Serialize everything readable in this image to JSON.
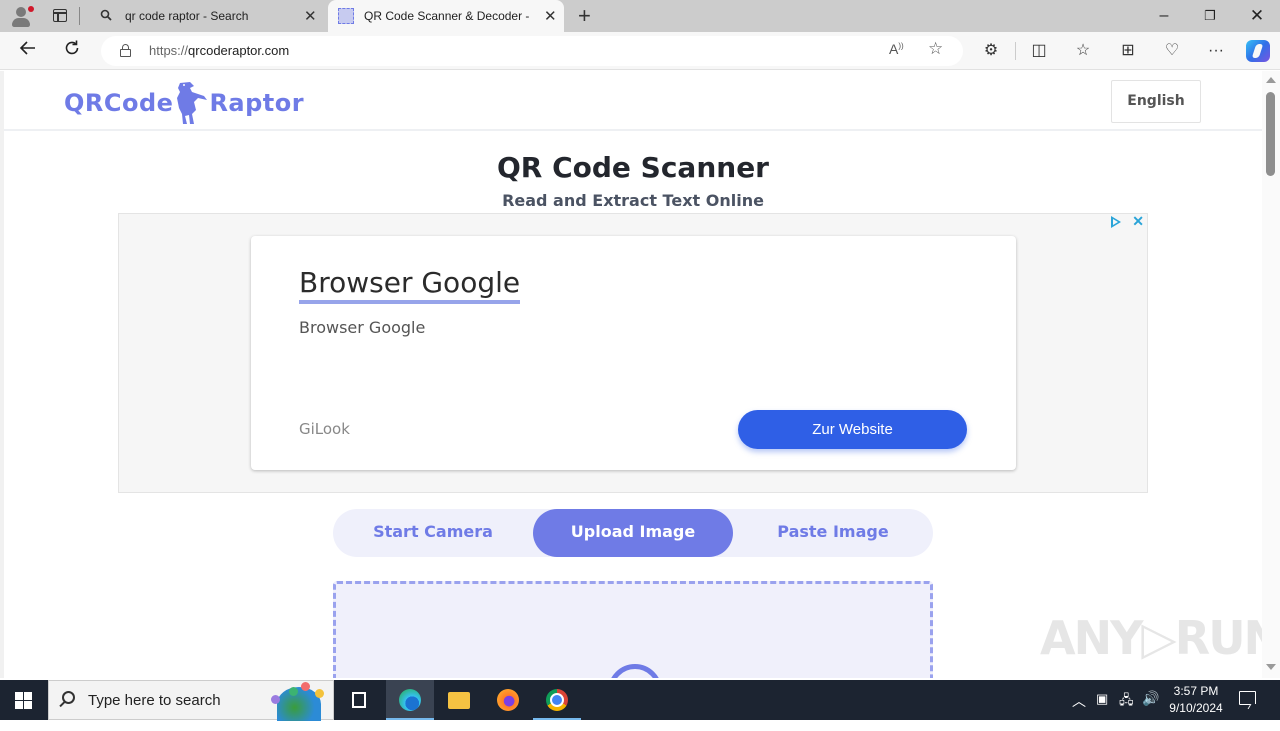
{
  "browser": {
    "tabs": [
      {
        "label": "qr code raptor - Search",
        "icon": "search-icon",
        "active": false
      },
      {
        "label": "QR Code Scanner & Decoder - QR",
        "icon": "qr-favicon",
        "active": true
      }
    ],
    "new_tab_label": "+",
    "url_protocol": "https://",
    "url_host": "qrcoderaptor.com",
    "window_controls": {
      "minimize": "–",
      "restore": "❐",
      "close": "✕"
    },
    "toolbar_icons": [
      "read-aloud-icon",
      "favorite-star-icon",
      "extensions-icon",
      "split-screen-icon",
      "favorites-icon",
      "collections-icon",
      "browser-essentials-icon",
      "more-icon",
      "copilot-icon"
    ]
  },
  "site": {
    "logo_left": "QRCode",
    "logo_right": "Raptor",
    "language_button": "English",
    "title": "QR Code Scanner",
    "subtitle": "Read and Extract Text Online"
  },
  "ad": {
    "headline": "Browser Google",
    "description": "Browser Google",
    "advertiser": "GiLook",
    "cta_label": "Zur Website",
    "close_label": "✕"
  },
  "modes": {
    "tabs": [
      "Start Camera",
      "Upload Image",
      "Paste Image"
    ],
    "selected": "Upload Image"
  },
  "watermark": "ANY▷RUN",
  "taskbar": {
    "search_placeholder": "Type here to search",
    "apps": [
      "task-view",
      "microsoft-edge",
      "file-explorer",
      "firefox",
      "chrome"
    ],
    "time": "3:57 PM",
    "date": "9/10/2024"
  },
  "colors": {
    "brand": "#6f7be6",
    "ad_cta": "#2f5fe6",
    "title_text": "#23262d",
    "taskbar_bg": "#1c2431"
  }
}
